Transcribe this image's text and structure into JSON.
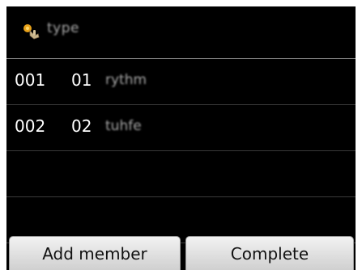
{
  "header": {
    "icon": "phonebook-hand-icon",
    "title": "type"
  },
  "members": [
    {
      "id": "001",
      "sub": "01",
      "name": "rythm"
    },
    {
      "id": "002",
      "sub": "02",
      "name": "tuhfe"
    }
  ],
  "buttons": {
    "add_member": "Add member",
    "complete": "Complete"
  }
}
